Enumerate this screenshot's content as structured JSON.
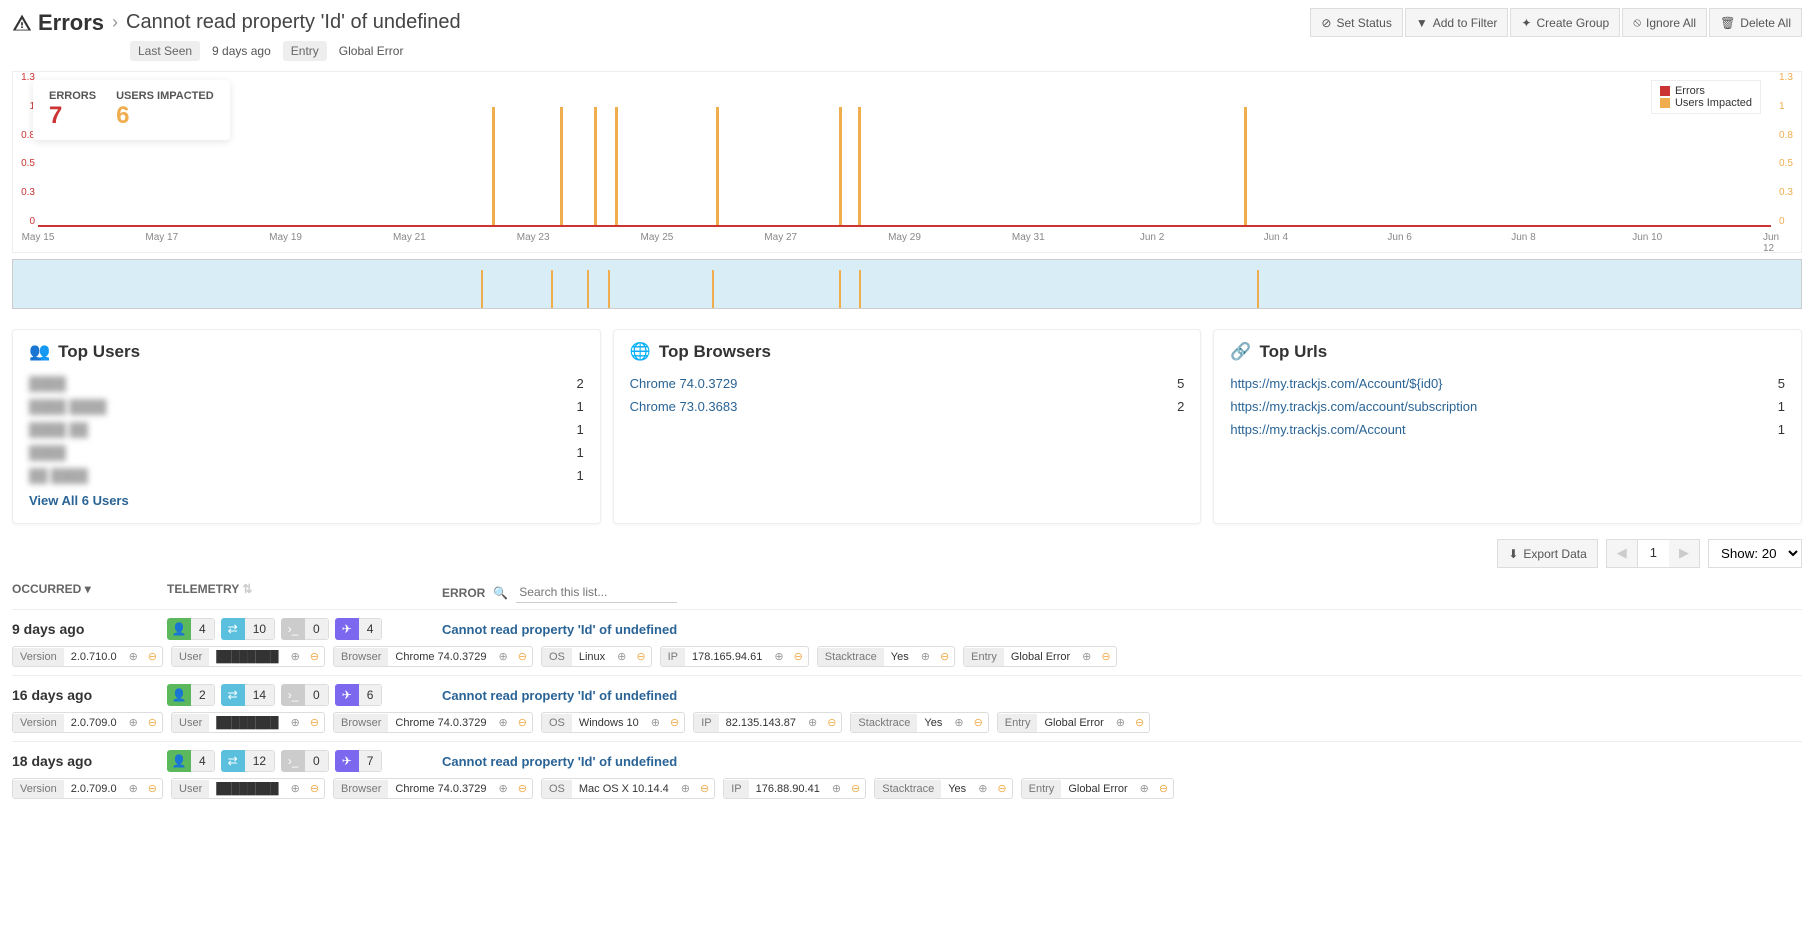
{
  "header": {
    "title": "Errors",
    "subtitle": "Cannot read property 'Id' of undefined",
    "meta": [
      {
        "k": "Last Seen",
        "v": "9 days ago"
      },
      {
        "k": "Entry",
        "v": "Global Error"
      }
    ],
    "actions": {
      "set_status": "Set Status",
      "add_filter": "Add to Filter",
      "create_group": "Create Group",
      "ignore_all": "Ignore All",
      "delete_all": "Delete All"
    }
  },
  "stats": {
    "errors_label": "ERRORS",
    "errors": "7",
    "users_label": "USERS IMPACTED",
    "users": "6"
  },
  "chart_data": {
    "type": "bar",
    "title": "",
    "xlabel": "",
    "ylabel": "",
    "ylim": [
      0,
      1.3
    ],
    "y_ticks": [
      "1.3",
      "1",
      "0.8",
      "0.5",
      "0.3",
      "0"
    ],
    "x_ticks": [
      "May 15",
      "May 17",
      "May 19",
      "May 21",
      "May 23",
      "May 25",
      "May 27",
      "May 29",
      "May 31",
      "Jun 2",
      "Jun 4",
      "Jun 6",
      "Jun 8",
      "Jun 10",
      "Jun 12"
    ],
    "series": [
      {
        "name": "Errors",
        "color": "#cc3333"
      },
      {
        "name": "Users Impacted",
        "color": "#f0ad4e"
      }
    ],
    "bars_pct_x": [
      26.2,
      30.1,
      32.1,
      33.3,
      39.1,
      46.2,
      47.3,
      69.6
    ]
  },
  "panels": {
    "top_users": {
      "title": "Top Users",
      "rows": [
        {
          "label": "████",
          "count": "2"
        },
        {
          "label": "████ ████",
          "count": "1"
        },
        {
          "label": "████ ██",
          "count": "1"
        },
        {
          "label": "████",
          "count": "1"
        },
        {
          "label": "██ ████",
          "count": "1"
        }
      ],
      "view_all": "View All 6 Users"
    },
    "top_browsers": {
      "title": "Top Browsers",
      "rows": [
        {
          "label": "Chrome 74.0.3729",
          "count": "5"
        },
        {
          "label": "Chrome 73.0.3683",
          "count": "2"
        }
      ]
    },
    "top_urls": {
      "title": "Top Urls",
      "rows": [
        {
          "label": "https://my.trackjs.com/Account/${id0}",
          "count": "5"
        },
        {
          "label": "https://my.trackjs.com/account/subscription",
          "count": "1"
        },
        {
          "label": "https://my.trackjs.com/Account",
          "count": "1"
        }
      ]
    }
  },
  "list": {
    "export": "Export Data",
    "page": "1",
    "show": "Show: 20",
    "col_occurred": "OCCURRED",
    "col_telemetry": "TELEMETRY",
    "col_error": "ERROR",
    "search_placeholder": "Search this list...",
    "rows": [
      {
        "occurred": "9 days ago",
        "tel": [
          4,
          10,
          0,
          4
        ],
        "msg": "Cannot read property 'Id' of undefined",
        "tags": [
          {
            "k": "Version",
            "v": "2.0.710.0"
          },
          {
            "k": "User",
            "v": "████████"
          },
          {
            "k": "Browser",
            "v": "Chrome 74.0.3729"
          },
          {
            "k": "OS",
            "v": "Linux"
          },
          {
            "k": "IP",
            "v": "178.165.94.61"
          },
          {
            "k": "Stacktrace",
            "v": "Yes"
          },
          {
            "k": "Entry",
            "v": "Global Error"
          }
        ]
      },
      {
        "occurred": "16 days ago",
        "tel": [
          2,
          14,
          0,
          6
        ],
        "msg": "Cannot read property 'Id' of undefined",
        "tags": [
          {
            "k": "Version",
            "v": "2.0.709.0"
          },
          {
            "k": "User",
            "v": "████████"
          },
          {
            "k": "Browser",
            "v": "Chrome 74.0.3729"
          },
          {
            "k": "OS",
            "v": "Windows 10"
          },
          {
            "k": "IP",
            "v": "82.135.143.87"
          },
          {
            "k": "Stacktrace",
            "v": "Yes"
          },
          {
            "k": "Entry",
            "v": "Global Error"
          }
        ]
      },
      {
        "occurred": "18 days ago",
        "tel": [
          4,
          12,
          0,
          7
        ],
        "msg": "Cannot read property 'Id' of undefined",
        "tags": [
          {
            "k": "Version",
            "v": "2.0.709.0"
          },
          {
            "k": "User",
            "v": "████████"
          },
          {
            "k": "Browser",
            "v": "Chrome 74.0.3729"
          },
          {
            "k": "OS",
            "v": "Mac OS X 10.14.4"
          },
          {
            "k": "IP",
            "v": "176.88.90.41"
          },
          {
            "k": "Stacktrace",
            "v": "Yes"
          },
          {
            "k": "Entry",
            "v": "Global Error"
          }
        ]
      }
    ]
  }
}
